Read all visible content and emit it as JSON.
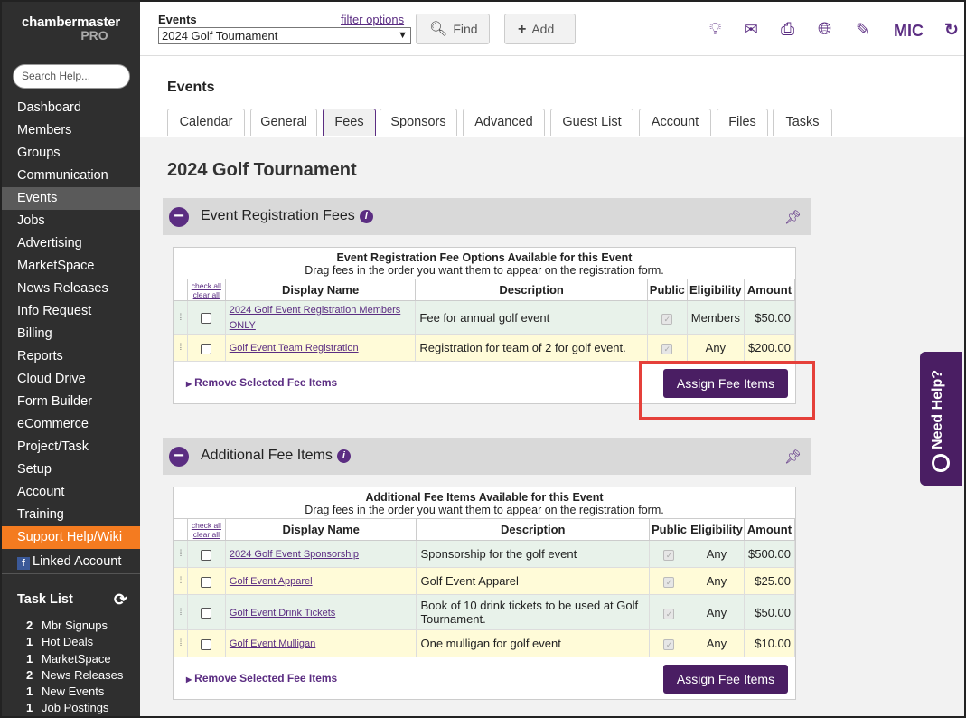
{
  "sidebar": {
    "logo_line1": "chambermaster",
    "logo_line2": "PRO",
    "search_placeholder": "Search Help...",
    "nav": [
      "Dashboard",
      "Members",
      "Groups",
      "Communication",
      "Events",
      "Jobs",
      "Advertising",
      "MarketSpace",
      "News Releases",
      "Info Request",
      "Billing",
      "Reports",
      "Cloud Drive",
      "Form Builder",
      "eCommerce",
      "Project/Task",
      "Setup",
      "Account",
      "Training"
    ],
    "active_nav": "Events",
    "support": "Support Help/Wiki",
    "linked": "Linked Account",
    "task_title": "Task List",
    "tasks": [
      {
        "count": "2",
        "label": "Mbr Signups"
      },
      {
        "count": "1",
        "label": "Hot Deals"
      },
      {
        "count": "1",
        "label": "MarketSpace"
      },
      {
        "count": "2",
        "label": "News Releases"
      },
      {
        "count": "1",
        "label": "New Events"
      },
      {
        "count": "1",
        "label": "Job Postings"
      }
    ]
  },
  "topbar": {
    "events_label": "Events",
    "filter": "filter options",
    "selected_event": "2024 Golf Tournament",
    "find": "Find",
    "add": "Add",
    "user": "MIC"
  },
  "page": {
    "title": "Events",
    "tabs": [
      "Calendar",
      "General",
      "Fees",
      "Sponsors",
      "Advanced",
      "Guest List",
      "Account",
      "Files",
      "Tasks"
    ],
    "active_tab": "Fees",
    "event_name": "2024 Golf Tournament"
  },
  "registration": {
    "title": "Event Registration Fees",
    "caption_title": "Event Registration Fee Options Available for this Event",
    "caption_sub": "Drag fees in the order you want them to appear on the registration form.",
    "rows": [
      {
        "name": "2024 Golf Event Registration Members ONLY",
        "description": "Fee for annual golf event",
        "eligibility": "Members",
        "amount": "$50.00"
      },
      {
        "name": "Golf Event Team Registration",
        "description": "Registration for team of 2 for golf event.",
        "eligibility": "Any",
        "amount": "$200.00"
      }
    ]
  },
  "additional": {
    "title": "Additional Fee Items",
    "caption_title": "Additional Fee Items Available for this Event",
    "caption_sub": "Drag fees in the order you want them to appear on the registration form.",
    "rows": [
      {
        "name": "2024 Golf Event Sponsorship",
        "description": "Sponsorship for the golf event",
        "eligibility": "Any",
        "amount": "$500.00"
      },
      {
        "name": "Golf Event Apparel",
        "description": "Golf Event Apparel",
        "eligibility": "Any",
        "amount": "$25.00"
      },
      {
        "name": "Golf Event Drink Tickets",
        "description": "Book of 10 drink tickets to be used at Golf Tournament.",
        "eligibility": "Any",
        "amount": "$50.00"
      },
      {
        "name": "Golf Event Mulligan",
        "description": "One mulligan for golf event",
        "eligibility": "Any",
        "amount": "$10.00"
      }
    ]
  },
  "table": {
    "check_all": "check all",
    "clear_all": "clear all",
    "display_name": "Display Name",
    "description": "Description",
    "public": "Public",
    "eligibility": "Eligibility",
    "amount": "Amount"
  },
  "actions": {
    "remove": "Remove Selected Fee Items",
    "assign": "Assign Fee Items"
  },
  "help_tab": "Need Help?",
  "colors": {
    "brand": "#5b2d82",
    "support": "#f47b20",
    "highlight": "#e5403a"
  }
}
